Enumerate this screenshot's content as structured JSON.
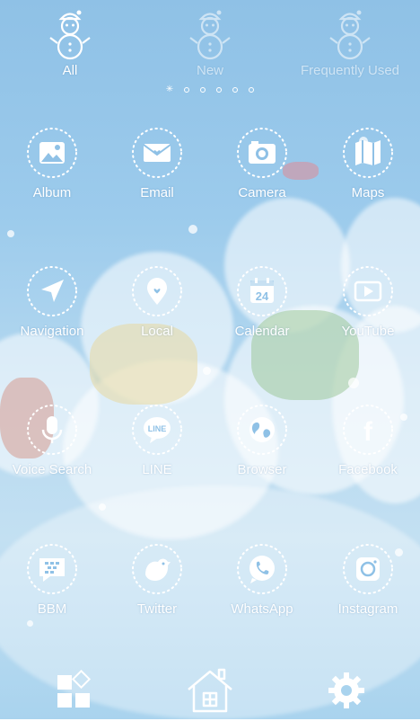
{
  "tabs": [
    {
      "label": "All",
      "active": true
    },
    {
      "label": "New",
      "active": false
    },
    {
      "label": "Frequently Used",
      "active": false
    }
  ],
  "page_indicator": {
    "pages": 6,
    "current": 1
  },
  "apps": [
    {
      "label": "Album",
      "icon": "album-icon"
    },
    {
      "label": "Email",
      "icon": "email-icon"
    },
    {
      "label": "Camera",
      "icon": "camera-icon"
    },
    {
      "label": "Maps",
      "icon": "maps-icon"
    },
    {
      "label": "Navigation",
      "icon": "navigation-icon"
    },
    {
      "label": "Local",
      "icon": "local-pin-icon"
    },
    {
      "label": "Calendar",
      "icon": "calendar-icon",
      "day": "24"
    },
    {
      "label": "YouTube",
      "icon": "youtube-play-icon"
    },
    {
      "label": "Voice Search",
      "icon": "microphone-icon"
    },
    {
      "label": "LINE",
      "icon": "line-icon",
      "glyph": "LINE"
    },
    {
      "label": "Browser",
      "icon": "globe-icon"
    },
    {
      "label": "Facebook",
      "icon": "facebook-icon",
      "glyph": "f"
    },
    {
      "label": "BBM",
      "icon": "bbm-icon"
    },
    {
      "label": "Twitter",
      "icon": "twitter-bird-icon"
    },
    {
      "label": "WhatsApp",
      "icon": "whatsapp-icon"
    },
    {
      "label": "Instagram",
      "icon": "instagram-icon"
    }
  ],
  "dock": [
    {
      "name": "widgets",
      "icon": "widgets-grid-icon"
    },
    {
      "name": "home",
      "icon": "house-icon"
    },
    {
      "name": "settings",
      "icon": "gear-icon"
    }
  ],
  "colors": {
    "accent": "#ffffff",
    "sky": "#9ccbec",
    "snow": "#eef6fb"
  }
}
